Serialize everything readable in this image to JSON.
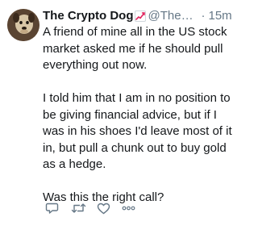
{
  "tweet": {
    "author_name": "The Crypto Dog",
    "author_emoji": "chart-increasing-emoji",
    "handle": "@TheC...",
    "separator": "·",
    "time": "15m",
    "paragraphs": [
      "A friend of mine all in the US stock market asked me if he should pull everything out now.",
      "I told him that I am in no position to be giving financial advice, but if I was in his shoes I'd leave most of it in, but pull a chunk out to buy gold as a hedge.",
      "Was this the right call?"
    ],
    "actions": [
      "reply-icon",
      "retweet-icon",
      "like-icon",
      "more-icon"
    ]
  },
  "colors": {
    "text": "#14171a",
    "muted": "#657786",
    "emoji_red": "#e0245e"
  }
}
